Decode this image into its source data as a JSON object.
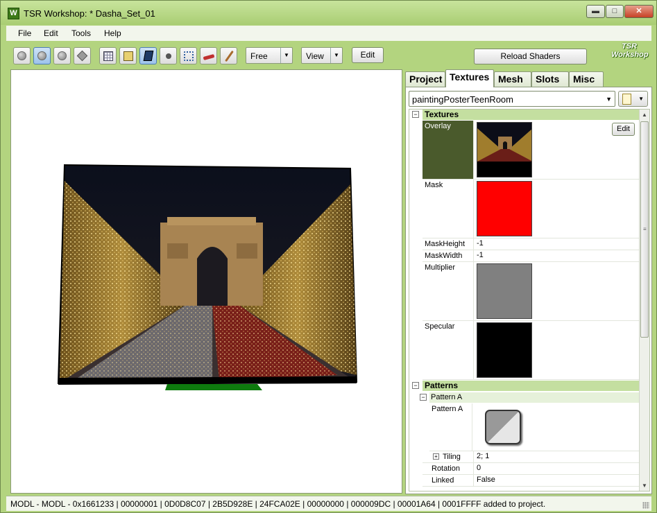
{
  "window": {
    "title": "TSR Workshop: * Dasha_Set_01",
    "app_icon": "W",
    "controls": [
      "minimize",
      "maximize",
      "close"
    ]
  },
  "menubar": {
    "items": [
      "File",
      "Edit",
      "Tools",
      "Help"
    ]
  },
  "toolbar": {
    "free_combo": "Free",
    "view_combo": "View",
    "edit_button": "Edit",
    "reload_button": "Reload Shaders",
    "logo_line1": "TSR",
    "logo_line2": "Workshop",
    "icons": [
      "render-solid-icon",
      "render-shaded-icon",
      "render-flat-icon",
      "render-diamond-icon",
      "grid-icon",
      "bounding-box-icon",
      "mesh-icon",
      "dot-icon",
      "joints-icon",
      "texture-paint-icon",
      "bone-icon"
    ]
  },
  "tabs": [
    "Project",
    "Textures",
    "Mesh",
    "Slots",
    "Misc"
  ],
  "active_tab": "Textures",
  "texture_selector": {
    "value": "paintingPosterTeenRoom"
  },
  "sections": {
    "textures": {
      "title": "Textures",
      "rows": {
        "overlay": {
          "key": "Overlay",
          "edit": "Edit"
        },
        "mask": {
          "key": "Mask",
          "color": "#ff0000"
        },
        "maskheight": {
          "key": "MaskHeight",
          "value": "-1"
        },
        "maskwidth": {
          "key": "MaskWidth",
          "value": "-1"
        },
        "multiplier": {
          "key": "Multiplier",
          "color": "#808080"
        },
        "specular": {
          "key": "Specular",
          "color": "#000000"
        }
      }
    },
    "patterns": {
      "title": "Patterns",
      "pattern_a": {
        "title": "Pattern A",
        "key": "Pattern A",
        "tiling_key": "Tiling",
        "tiling_value": "2; 1",
        "rotation_key": "Rotation",
        "rotation_value": "0",
        "linked_key": "Linked",
        "linked_value": "False"
      }
    }
  },
  "statusbar": {
    "text": "MODL - MODL - 0x1661233 | 00000001 | 0D0D8C07 | 2B5D928E | 24FCA02E | 00000000 | 000009DC | 00001A64 | 0001FFFF added to project."
  },
  "colors": {
    "chrome_green": "#b3d47f",
    "section_header": "#c4dfa0",
    "selected_key": "#4a5a2c"
  }
}
